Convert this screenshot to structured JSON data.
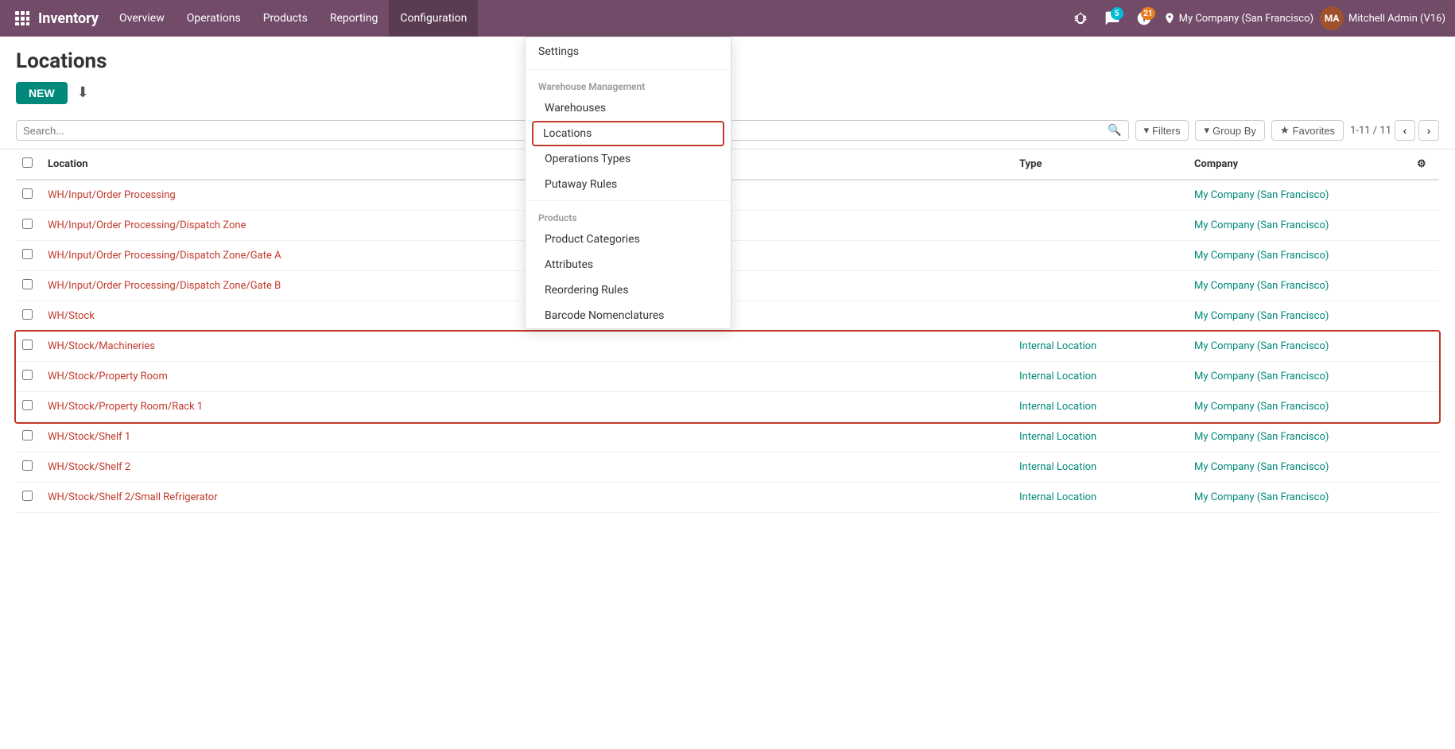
{
  "app": {
    "name": "Inventory",
    "nav_items": [
      {
        "id": "overview",
        "label": "Overview"
      },
      {
        "id": "operations",
        "label": "Operations"
      },
      {
        "id": "products",
        "label": "Products"
      },
      {
        "id": "reporting",
        "label": "Reporting"
      },
      {
        "id": "configuration",
        "label": "Configuration",
        "active": true
      }
    ],
    "company": "My Company (San Francisco)",
    "user": "Mitchell Admin (V16)",
    "messages_count": "5",
    "activities_count": "21"
  },
  "page": {
    "title": "Locations",
    "new_button": "NEW",
    "pagination": "1-11 / 11"
  },
  "filter_bar": {
    "filters_label": "Filters",
    "group_by_label": "Group By",
    "favorites_label": "Favorites",
    "search_placeholder": "Search..."
  },
  "table": {
    "headers": {
      "location": "Location",
      "type": "Type",
      "company": "Company"
    },
    "rows": [
      {
        "id": 1,
        "location": "WH/Input/Order Processing",
        "type": "",
        "company": "My Company (San Francisco)",
        "highlighted": false
      },
      {
        "id": 2,
        "location": "WH/Input/Order Processing/Dispatch Zone",
        "type": "",
        "company": "My Company (San Francisco)",
        "highlighted": false
      },
      {
        "id": 3,
        "location": "WH/Input/Order Processing/Dispatch Zone/Gate A",
        "type": "",
        "company": "My Company (San Francisco)",
        "highlighted": false
      },
      {
        "id": 4,
        "location": "WH/Input/Order Processing/Dispatch Zone/Gate B",
        "type": "",
        "company": "My Company (San Francisco)",
        "highlighted": false
      },
      {
        "id": 5,
        "location": "WH/Stock",
        "type": "",
        "company": "My Company (San Francisco)",
        "highlighted": false
      },
      {
        "id": 6,
        "location": "WH/Stock/Machineries",
        "type": "Internal Location",
        "company": "My Company (San Francisco)",
        "highlighted": true
      },
      {
        "id": 7,
        "location": "WH/Stock/Property Room",
        "type": "Internal Location",
        "company": "My Company (San Francisco)",
        "highlighted": true
      },
      {
        "id": 8,
        "location": "WH/Stock/Property Room/Rack 1",
        "type": "Internal Location",
        "company": "My Company (San Francisco)",
        "highlighted": true
      },
      {
        "id": 9,
        "location": "WH/Stock/Shelf 1",
        "type": "Internal Location",
        "company": "My Company (San Francisco)",
        "highlighted": false
      },
      {
        "id": 10,
        "location": "WH/Stock/Shelf 2",
        "type": "Internal Location",
        "company": "My Company (San Francisco)",
        "highlighted": false
      },
      {
        "id": 11,
        "location": "WH/Stock/Shelf 2/Small Refrigerator",
        "type": "Internal Location",
        "company": "My Company (San Francisco)",
        "highlighted": false
      }
    ]
  },
  "dropdown": {
    "settings_label": "Settings",
    "warehouse_management_label": "Warehouse Management",
    "warehouses_label": "Warehouses",
    "locations_label": "Locations",
    "operations_types_label": "Operations Types",
    "putaway_rules_label": "Putaway Rules",
    "products_label": "Products",
    "product_categories_label": "Product Categories",
    "attributes_label": "Attributes",
    "reordering_rules_label": "Reordering Rules",
    "barcode_nomenclatures_label": "Barcode Nomenclatures"
  }
}
